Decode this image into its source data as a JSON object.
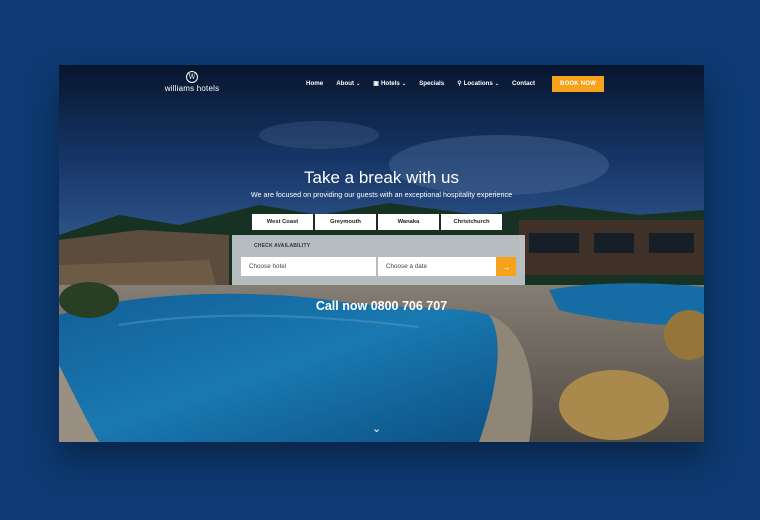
{
  "brand": {
    "name": "williams hotels",
    "mark": "W"
  },
  "nav": {
    "items": [
      {
        "label": "Home",
        "has_dropdown": false,
        "icon": ""
      },
      {
        "label": "About",
        "has_dropdown": true,
        "icon": ""
      },
      {
        "label": "Hotels",
        "has_dropdown": true,
        "icon": "bed-icon"
      },
      {
        "label": "Specials",
        "has_dropdown": false,
        "icon": ""
      },
      {
        "label": "Locations",
        "has_dropdown": true,
        "icon": "map-pin-icon"
      },
      {
        "label": "Contact",
        "has_dropdown": false,
        "icon": ""
      }
    ],
    "cta": "BOOK NOW"
  },
  "hero": {
    "headline": "Take a break with us",
    "subheadline": "We are focused on providing our guests with an exceptional hospitality experience",
    "call": "Call now 0800 706 707"
  },
  "regions": [
    "West Coast",
    "Greymouth",
    "Wanaka",
    "Christchurch"
  ],
  "availability": {
    "title": "CHECK AVAILABILITY",
    "hotel_placeholder": "Choose hotel",
    "date_placeholder": "Choose a date",
    "submit_icon": "arrow-right-icon"
  },
  "colors": {
    "page_bg": "#0d3a72",
    "accent": "#f6a21a",
    "water": "#1f7fbf"
  }
}
